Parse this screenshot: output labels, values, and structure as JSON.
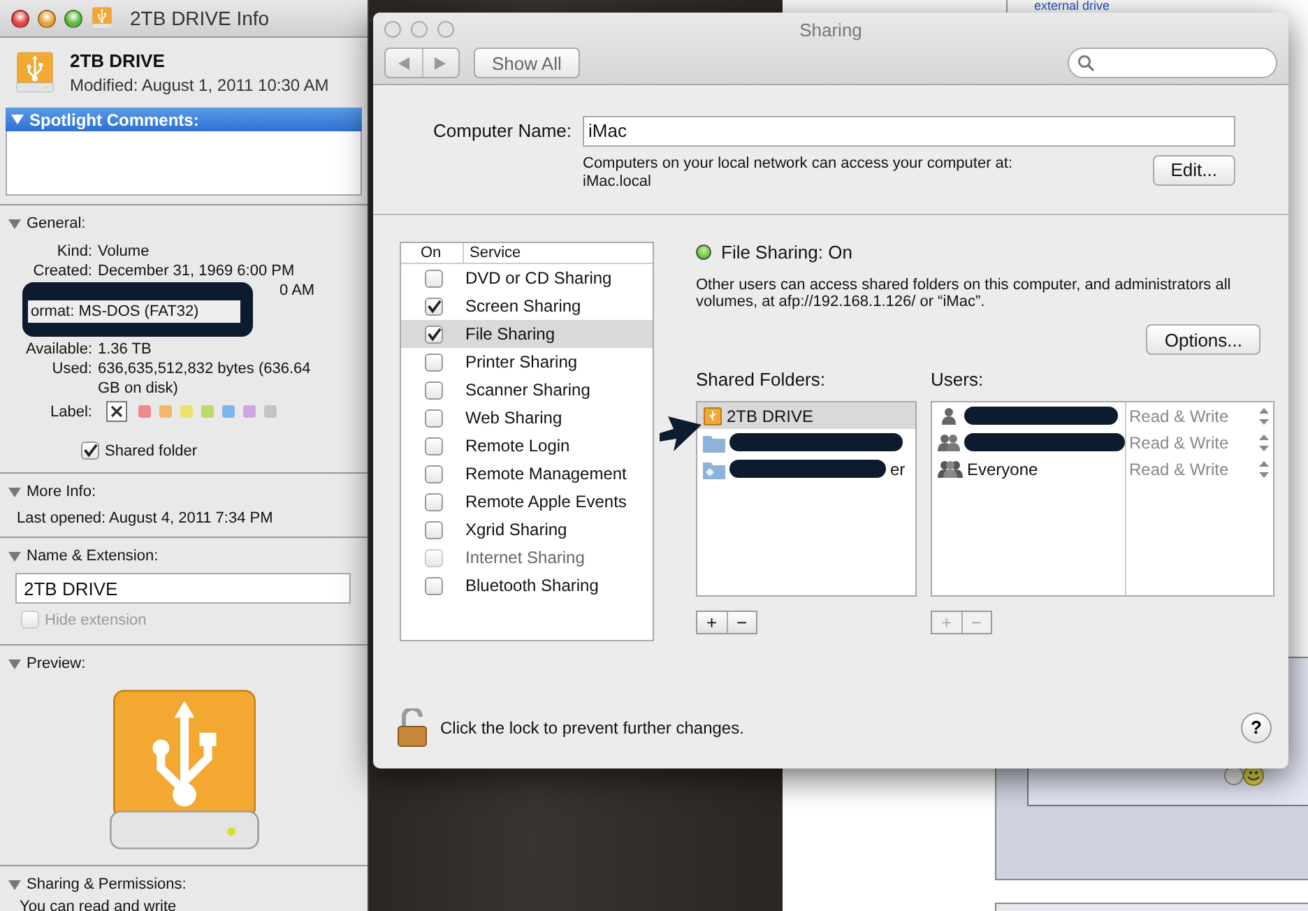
{
  "background": {
    "sidebar_item": "external drive"
  },
  "info_window": {
    "title": "2TB DRIVE Info",
    "name": "2TB DRIVE",
    "modified": "Modified: August 1, 2011 10:30 AM",
    "spotlight": {
      "label": "Spotlight Comments:",
      "expanded": true,
      "selected": true
    },
    "general": {
      "label": "General:",
      "expanded": true,
      "rows_top": [
        {
          "label": "Kind:",
          "value": "Volume"
        },
        {
          "label": "Created:",
          "value": "December 31, 1969 6:00 PM"
        }
      ],
      "partial_value": "0 AM",
      "format": {
        "label": "ormat:",
        "value": "MS-DOS (FAT32)"
      },
      "rows_bottom": [
        {
          "label": "Available:",
          "value": "1.36 TB"
        },
        {
          "label": "Used:",
          "value": "636,635,512,832 bytes (636.64 GB on disk)"
        }
      ],
      "label_title": "Label:",
      "labels": [
        {
          "kind": "none",
          "selected": true
        },
        {
          "kind": "color",
          "color": "#f08a8a",
          "selected": false
        },
        {
          "kind": "color",
          "color": "#f4b66a",
          "selected": false
        },
        {
          "kind": "color",
          "color": "#ece46a",
          "selected": false
        },
        {
          "kind": "color",
          "color": "#bcdc6a",
          "selected": false
        },
        {
          "kind": "color",
          "color": "#7cb6f0",
          "selected": false
        },
        {
          "kind": "color",
          "color": "#cfa6e2",
          "selected": false
        },
        {
          "kind": "color",
          "color": "#c4c4c4",
          "selected": false
        }
      ],
      "shared_folder": {
        "label": "Shared folder",
        "checked": true
      }
    },
    "more_info": {
      "label": "More Info:",
      "expanded": true,
      "last_opened": "Last opened: August 4, 2011 7:34 PM"
    },
    "name_extension": {
      "label": "Name & Extension:",
      "expanded": true,
      "value": "2TB DRIVE",
      "hide_extension": {
        "label": "Hide extension",
        "checked": false,
        "disabled": true
      }
    },
    "preview": {
      "label": "Preview:",
      "expanded": true
    },
    "sharing": {
      "label": "Sharing & Permissions:",
      "expanded": true,
      "text": "You can read and write"
    }
  },
  "sharing_window": {
    "title": "Sharing",
    "show_all": "Show All",
    "computer_name": {
      "label": "Computer Name:",
      "value": "iMac",
      "note": "Computers on your local network can access your computer at:",
      "address": "iMac.local",
      "edit": "Edit..."
    },
    "services": {
      "columns": [
        "On",
        "Service"
      ],
      "rows": [
        {
          "name": "DVD or CD Sharing",
          "checked": false,
          "selected": false,
          "disabled": false
        },
        {
          "name": "Screen Sharing",
          "checked": true,
          "selected": false,
          "disabled": false
        },
        {
          "name": "File Sharing",
          "checked": true,
          "selected": true,
          "disabled": false
        },
        {
          "name": "Printer Sharing",
          "checked": false,
          "selected": false,
          "disabled": false
        },
        {
          "name": "Scanner Sharing",
          "checked": false,
          "selected": false,
          "disabled": false
        },
        {
          "name": "Web Sharing",
          "checked": false,
          "selected": false,
          "disabled": false
        },
        {
          "name": "Remote Login",
          "checked": false,
          "selected": false,
          "disabled": false
        },
        {
          "name": "Remote Management",
          "checked": false,
          "selected": false,
          "disabled": false
        },
        {
          "name": "Remote Apple Events",
          "checked": false,
          "selected": false,
          "disabled": false
        },
        {
          "name": "Xgrid Sharing",
          "checked": false,
          "selected": false,
          "disabled": false
        },
        {
          "name": "Internet Sharing",
          "checked": false,
          "selected": false,
          "disabled": true
        },
        {
          "name": "Bluetooth Sharing",
          "checked": false,
          "selected": false,
          "disabled": false
        }
      ]
    },
    "status": {
      "text": "File Sharing: On",
      "on": true,
      "description": "Other users can access shared folders on this computer, and administrators all volumes, at afp://192.168.1.126/ or “iMac”.",
      "options": "Options..."
    },
    "shared_folders": {
      "label": "Shared Folders:",
      "items": [
        {
          "kind": "drive",
          "name": "2TB DRIVE",
          "redacted": false,
          "selected": true
        },
        {
          "kind": "folder",
          "redacted": true,
          "selected": false
        },
        {
          "kind": "network",
          "name": "er",
          "redacted": true,
          "selected": false
        }
      ],
      "add": "+",
      "remove": "−",
      "disabled": false
    },
    "users": {
      "label": "Users:",
      "items": [
        {
          "kind": "user",
          "redacted": true,
          "permission": "Read & Write"
        },
        {
          "kind": "group",
          "redacted": true,
          "permission": "Read & Write"
        },
        {
          "kind": "everyone",
          "name": "Everyone",
          "redacted": false,
          "permission": "Read & Write"
        }
      ],
      "add": "+",
      "remove": "−",
      "disabled": true
    },
    "lock": {
      "text": "Click the lock to prevent further changes.",
      "locked": false
    },
    "help": "?"
  }
}
